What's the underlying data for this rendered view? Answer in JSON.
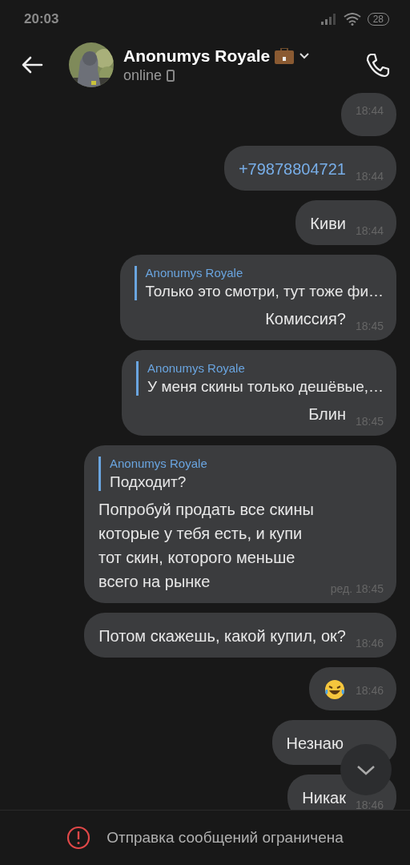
{
  "status_bar": {
    "time": "20:03",
    "battery": "28"
  },
  "header": {
    "name": "Anonumys Royale",
    "status": "online"
  },
  "messages": [
    {
      "kind": "text",
      "time": "18:44"
    },
    {
      "kind": "link",
      "text": "+79878804721",
      "time": "18:44"
    },
    {
      "kind": "text",
      "text": "Киви",
      "time": "18:44"
    },
    {
      "kind": "reply",
      "reply_author": "Anonumys Royale",
      "reply_text": "Только это смотри, тут тоже фи…",
      "text": "Комиссия?",
      "time": "18:45"
    },
    {
      "kind": "reply",
      "reply_author": "Anonumys Royale",
      "reply_text": "У меня скины только дешёвые,…",
      "text": "Блин",
      "time": "18:45"
    },
    {
      "kind": "reply",
      "reply_author": "Anonumys Royale",
      "reply_text": "Подходит?",
      "text": "Попробуй продать все скины которые у тебя есть, и купи тот скин, которого меньше всего на рынке",
      "time": "ред. 18:45"
    },
    {
      "kind": "text",
      "text": "Потом скажешь, какой купил, ок?",
      "time": "18:46"
    },
    {
      "kind": "emoji",
      "time": "18:46"
    },
    {
      "kind": "text",
      "text": "Незнаю"
    },
    {
      "kind": "text",
      "text": "Никак",
      "time": "18:46"
    }
  ],
  "footer": {
    "notice": "Отправка сообщений ограничена"
  }
}
